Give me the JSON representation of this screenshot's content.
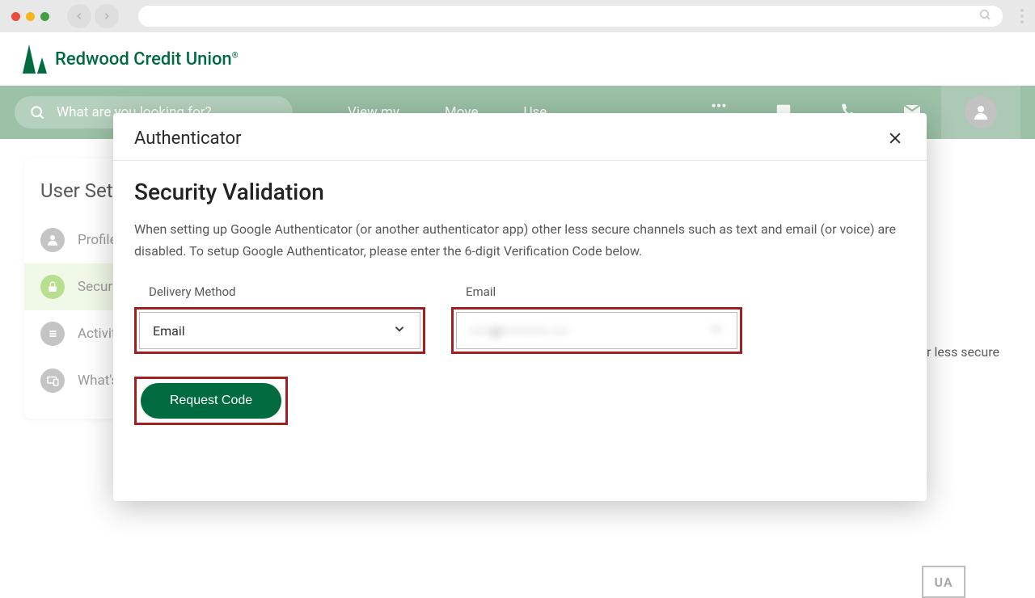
{
  "logo": {
    "text": "Redwood Credit Union"
  },
  "header": {
    "search_placeholder": "What are you looking for?",
    "tabs": [
      "View my",
      "Move",
      "Use"
    ]
  },
  "sidebar": {
    "title": "User Settings",
    "items": [
      {
        "label": "Profile"
      },
      {
        "label": "Security"
      },
      {
        "label": "Activity"
      },
      {
        "label": "What's"
      }
    ]
  },
  "background_fragment": "her less secure",
  "ncua": "UA",
  "modal": {
    "header": "Authenticator",
    "title": "Security Validation",
    "description": "When setting up Google Authenticator (or another authenticator app) other less secure channels such as text and email (or voice) are disabled. To setup Google Authenticator, please enter the 6-digit Verification Code below.",
    "delivery_method_label": "Delivery Method",
    "delivery_method_value": "Email",
    "email_label": "Email",
    "email_value_masked": "••••@•••••••••.•••",
    "button_label": "Request Code"
  }
}
